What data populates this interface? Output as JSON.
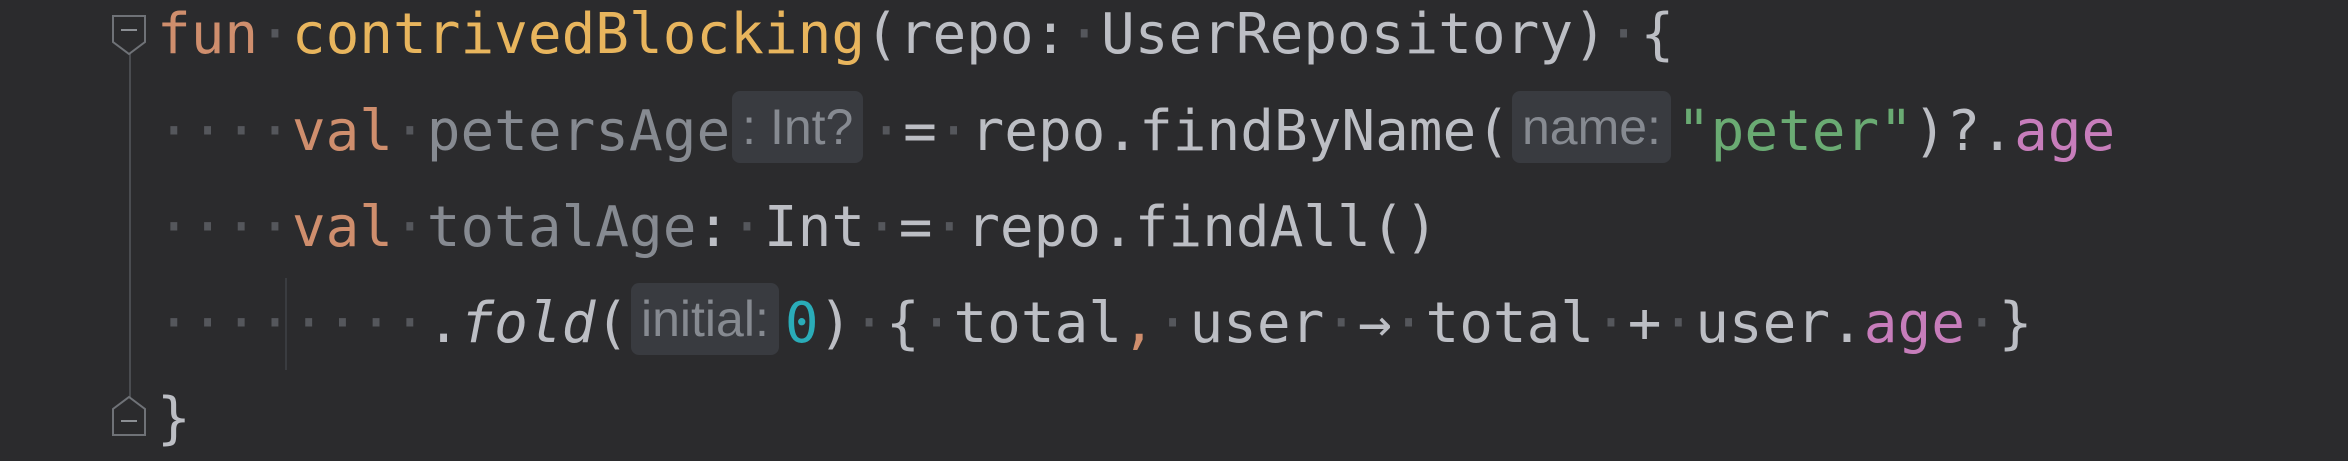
{
  "editor": {
    "line1": {
      "kw_fun": "fun",
      "fn_name": "contrivedBlocking",
      "open_paren": "(",
      "param": "repo:",
      "param_type": "UserRepository",
      "close": ")",
      "brace": "{"
    },
    "line2": {
      "kw_val": "val",
      "var_name": "petersAge",
      "type_hint": ": Int?",
      "eq": "=",
      "call": "repo.findByName(",
      "param_hint": "name:",
      "arg": "\"peter\"",
      "safe": ")?.",
      "prop": "age"
    },
    "line3": {
      "kw_val": "val",
      "var_name": "totalAge",
      "colon": ":",
      "type": "Int",
      "eq": "=",
      "call": "repo.findAll()"
    },
    "line4": {
      "dot": ".",
      "fold": "fold",
      "open": "(",
      "param_hint": "initial:",
      "zero": "0",
      "close": ")",
      "lbrace": "{",
      "total": "total",
      "comma": ",",
      "user": "user",
      "arrow": "→",
      "total2": "total",
      "plus": "+",
      "user2": "user.",
      "age": "age",
      "rbrace": "}"
    },
    "line5": {
      "brace": "}"
    }
  },
  "colors": {
    "background": "#2b2b2d",
    "keyword": "#cf8e6d",
    "function": "#e8b55d",
    "string": "#6aab73",
    "number": "#2aacb8",
    "property": "#c77dbb",
    "hint_bg": "#393b40"
  },
  "icons": {
    "fold_top": "fold-collapse-icon",
    "fold_bottom": "fold-end-icon"
  }
}
